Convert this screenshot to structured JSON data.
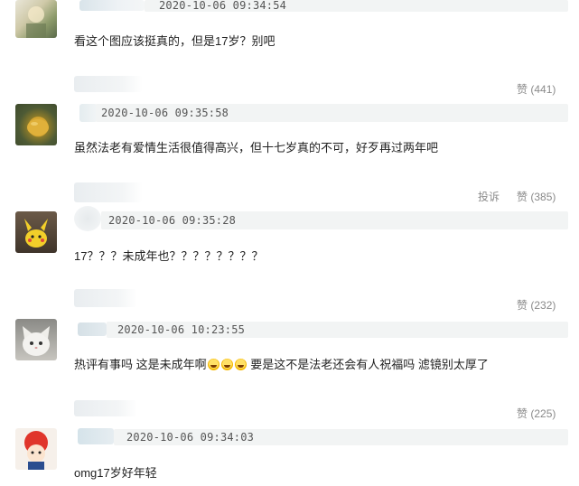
{
  "comments": [
    {
      "time": "2020-10-06 09:34:54",
      "text": "看这个图应该挺真的，但是17岁？别吧",
      "like_label": "赞",
      "like_count": "(441)"
    },
    {
      "time": "2020-10-06 09:35:58",
      "text": "虽然法老有爱情生活很值得高兴，但十七岁真的不可，好歹再过两年吧",
      "report_label": "投诉",
      "like_label": "赞",
      "like_count": "(385)"
    },
    {
      "time": "2020-10-06 09:35:28",
      "text": "17？？？未成年也？？？？？？？？",
      "like_label": "赞",
      "like_count": "(232)"
    },
    {
      "time": "2020-10-06 10:23:55",
      "text_a": "热评有事吗 这是未成年啊",
      "text_b": " 要是这不是法老还会有人祝福吗 滤镜别太厚了",
      "like_label": "赞",
      "like_count": "(225)"
    },
    {
      "time": "2020-10-06 09:34:03",
      "text": "omg17岁好年轻"
    }
  ],
  "icons": {
    "emoji": "laughing-tears-emoji"
  }
}
